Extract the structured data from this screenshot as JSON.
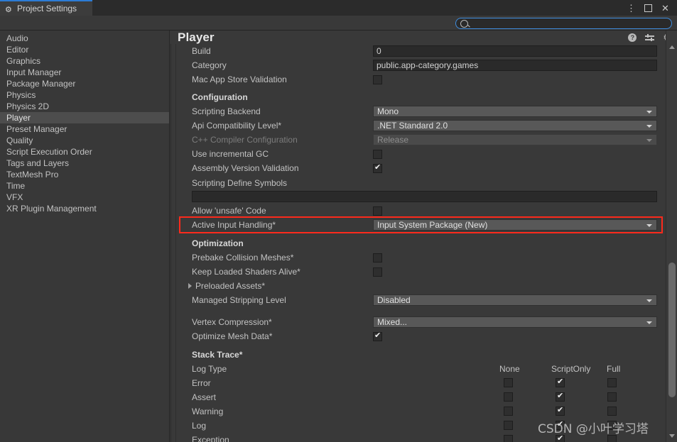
{
  "window": {
    "tab_label": "Project Settings",
    "tab_icon": "gear-icon",
    "more_label": "⋮",
    "close_label": "✕"
  },
  "search": {
    "value": "",
    "placeholder": "",
    "icon": "search-icon"
  },
  "sidebar": {
    "items": [
      {
        "label": "Audio",
        "selected": false
      },
      {
        "label": "Editor",
        "selected": false
      },
      {
        "label": "Graphics",
        "selected": false
      },
      {
        "label": "Input Manager",
        "selected": false
      },
      {
        "label": "Package Manager",
        "selected": false
      },
      {
        "label": "Physics",
        "selected": false
      },
      {
        "label": "Physics 2D",
        "selected": false
      },
      {
        "label": "Player",
        "selected": true
      },
      {
        "label": "Preset Manager",
        "selected": false
      },
      {
        "label": "Quality",
        "selected": false
      },
      {
        "label": "Script Execution Order",
        "selected": false
      },
      {
        "label": "Tags and Layers",
        "selected": false
      },
      {
        "label": "TextMesh Pro",
        "selected": false
      },
      {
        "label": "Time",
        "selected": false
      },
      {
        "label": "VFX",
        "selected": false
      },
      {
        "label": "XR Plugin Management",
        "selected": false
      }
    ]
  },
  "panel": {
    "title": "Player",
    "icons": {
      "help": "?",
      "preset": "preset-sliders-icon",
      "settings": "gear-icon"
    }
  },
  "fields": {
    "build_label": "Build",
    "build_value": "0",
    "category_label": "Category",
    "category_value": "public.app-category.games",
    "mac_validation_label": "Mac App Store Validation",
    "configuration_header": "Configuration",
    "scripting_backend_label": "Scripting Backend",
    "scripting_backend_value": "Mono",
    "api_level_label": "Api Compatibility Level*",
    "api_level_value": ".NET Standard 2.0",
    "cpp_compiler_label": "C++ Compiler Configuration",
    "cpp_compiler_value": "Release",
    "incremental_gc_label": "Use incremental GC",
    "assembly_validation_label": "Assembly Version Validation",
    "define_symbols_label": "Scripting Define Symbols",
    "define_symbols_value": "",
    "unsafe_code_label": "Allow 'unsafe' Code",
    "active_input_label": "Active Input Handling*",
    "active_input_value": "Input System Package (New)",
    "optimization_header": "Optimization",
    "prebake_label": "Prebake Collision Meshes*",
    "keep_shaders_label": "Keep Loaded Shaders Alive*",
    "preloaded_assets_label": "Preloaded Assets*",
    "managed_stripping_label": "Managed Stripping Level",
    "managed_stripping_value": "Disabled",
    "vertex_compression_label": "Vertex Compression*",
    "vertex_compression_value": "Mixed...",
    "optimize_mesh_label": "Optimize Mesh Data*",
    "stack_trace_header": "Stack Trace*",
    "log_type_label": "Log Type"
  },
  "stack_trace": {
    "columns": [
      "None",
      "ScriptOnly",
      "Full"
    ],
    "rows": [
      {
        "label": "Error",
        "none": false,
        "scriptonly": true,
        "full": false
      },
      {
        "label": "Assert",
        "none": false,
        "scriptonly": true,
        "full": false
      },
      {
        "label": "Warning",
        "none": false,
        "scriptonly": true,
        "full": false
      },
      {
        "label": "Log",
        "none": false,
        "scriptonly": true,
        "full": false
      },
      {
        "label": "Exception",
        "none": false,
        "scriptonly": true,
        "full": false
      }
    ]
  },
  "highlight": {
    "color": "#fc2a1c",
    "target": "Active Input Handling*"
  },
  "watermark": {
    "text": "CSDN @小叶学习塔"
  }
}
